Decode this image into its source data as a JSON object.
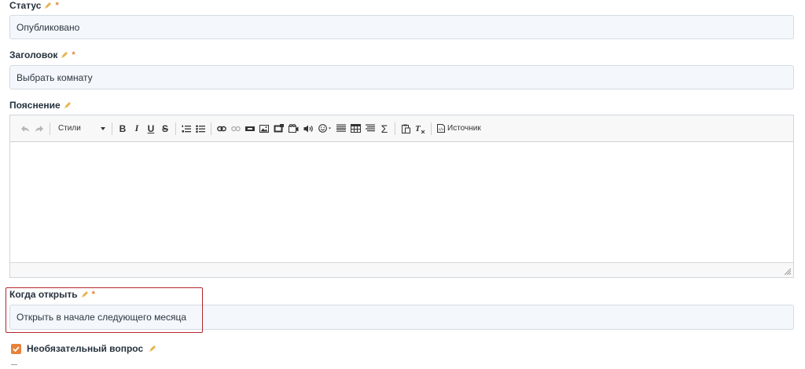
{
  "colors": {
    "accent": "#e8823a",
    "highlight_border": "#b4252a",
    "field_bg": "#f4f7fb"
  },
  "status": {
    "label": "Статус",
    "required_mark": "*",
    "value": "Опубликовано"
  },
  "title_field": {
    "label": "Заголовок",
    "required_mark": "*",
    "value": "Выбрать комнату"
  },
  "explanation": {
    "label": "Пояснение",
    "toolbar": {
      "styles_label": "Стили",
      "bold": "B",
      "italic": "I",
      "underline": "U",
      "strike": "S",
      "source_label": "Источник",
      "icons": [
        "undo-icon",
        "redo-icon",
        "bold-icon",
        "italic-icon",
        "underline-icon",
        "strikethrough-icon",
        "numbered-list-icon",
        "bulleted-list-icon",
        "link-icon",
        "unlink-icon",
        "anchor-icon",
        "image-icon",
        "image-upload-icon",
        "video-icon",
        "audio-icon",
        "emoji-icon",
        "horizontal-line-icon",
        "table-icon",
        "align-icon",
        "formula-icon",
        "paste-icon",
        "clear-format-icon",
        "source-icon"
      ]
    }
  },
  "when_open": {
    "label": "Когда открыть",
    "required_mark": "*",
    "value": "Открыть в начале следующего месяца"
  },
  "optional_question": {
    "label": "Необязательный вопрос",
    "checked": true
  }
}
